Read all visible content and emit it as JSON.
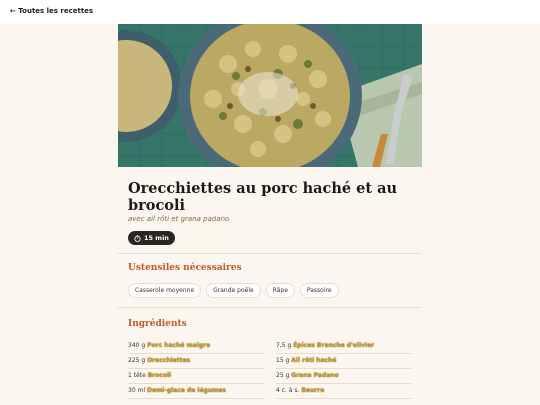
{
  "nav": {
    "back_label": "← Toutes les recettes"
  },
  "recipe": {
    "title": "Orecchiettes au porc haché et au brocoli",
    "subtitle": "avec ail rôti et grana padano",
    "time": "15 min"
  },
  "utensils": {
    "heading": "Ustensiles nécessaires",
    "items": [
      "Casserole moyenne",
      "Grande poêle",
      "Râpe",
      "Passoire"
    ]
  },
  "ingredients": {
    "heading": "Ingrédients",
    "items": [
      {
        "qty": "340 g",
        "name": "Porc haché maigre"
      },
      {
        "qty": "7,5 g",
        "name": "Épices Branche d'olivier"
      },
      {
        "qty": "225 g",
        "name": "Orecchiettes"
      },
      {
        "qty": "15 g",
        "name": "Ail rôti haché"
      },
      {
        "qty": "1 tête",
        "name": "Brocoli"
      },
      {
        "qty": "25 g",
        "name": "Grana Padano"
      },
      {
        "qty": "30 ml",
        "name": "Demi-glace de légumes"
      },
      {
        "qty": "4 c. à s.",
        "name": "Beurre"
      }
    ]
  },
  "colors": {
    "accent": "#c2572a",
    "background": "#fbf7f0",
    "pill": "#2a2622"
  }
}
